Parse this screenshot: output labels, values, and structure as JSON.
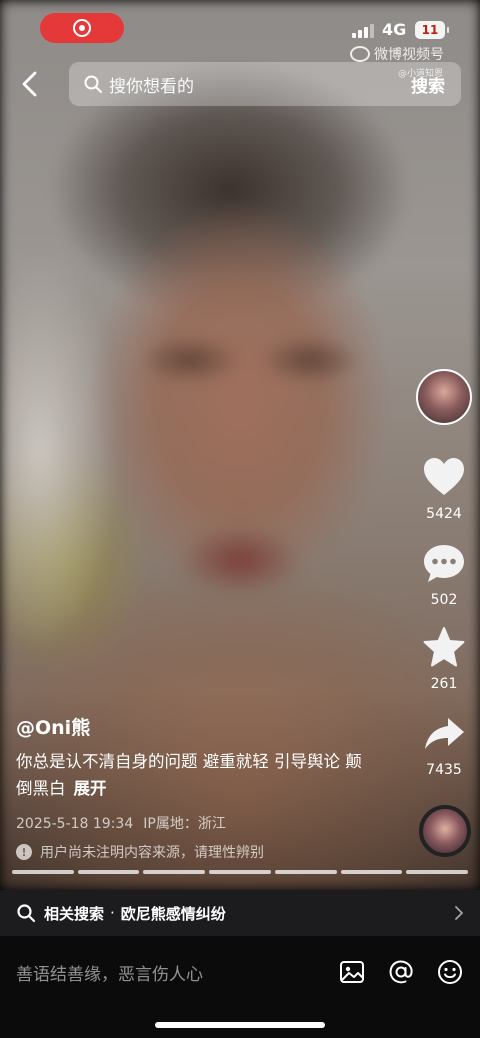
{
  "status": {
    "network": "4G",
    "battery": "11"
  },
  "watermark": {
    "brand": "微博视频号",
    "handle": "@小道知恩"
  },
  "search": {
    "placeholder": "搜你想看的",
    "submit_label": "搜索"
  },
  "actions": {
    "likes": "5424",
    "comments": "502",
    "favorites": "261",
    "shares": "7435"
  },
  "post": {
    "author": "@Oni熊",
    "caption": "你总是认不清自身的问题 避重就轻 引导舆论 颠倒黑白",
    "expand_label": "展开",
    "date": "2025-5-18 19:34",
    "location": "IP属地：浙江",
    "notice": "用户尚未注明内容来源，请理性辨别"
  },
  "related": {
    "label": "相关搜索",
    "separator": "·",
    "query": "欧尼熊感情纠纷"
  },
  "comment_bar": {
    "placeholder": "善语结善缘，恶言伤人心"
  },
  "colors": {
    "record": "#e53838",
    "bar_bg": "#0b0b0b",
    "related_bg": "#1c1c1e"
  },
  "icons": [
    "record-icon",
    "back-icon",
    "search-icon",
    "heart-icon",
    "comment-icon",
    "star-icon",
    "share-icon",
    "image-icon",
    "at-icon",
    "emoji-icon",
    "chevron-right-icon"
  ]
}
